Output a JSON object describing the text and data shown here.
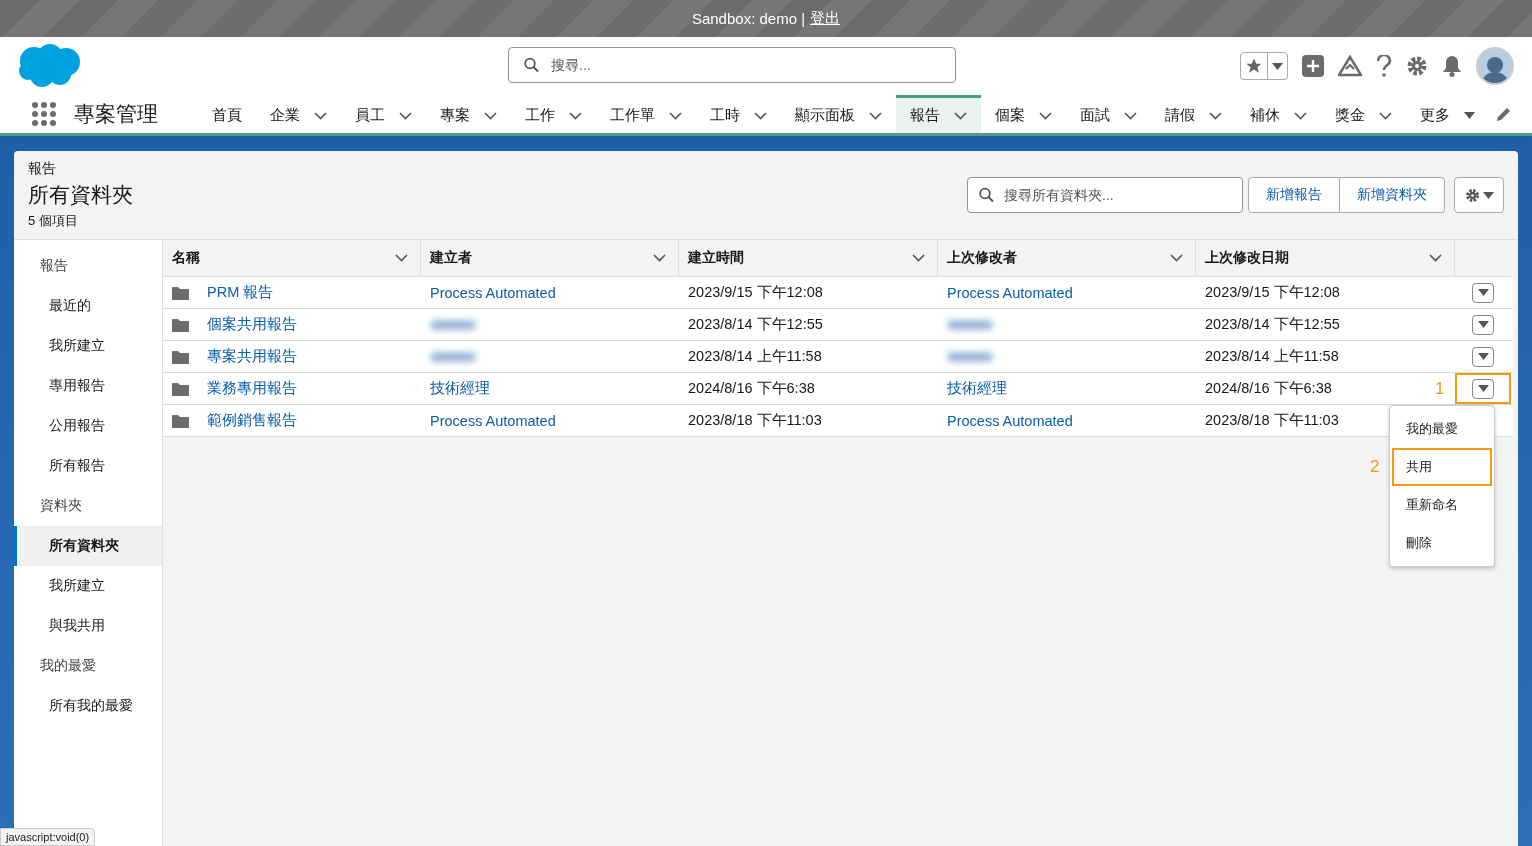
{
  "sandbox_bar": {
    "text": "Sandbox: demo |",
    "link": "登出"
  },
  "header": {
    "search": {
      "placeholder": "搜尋..."
    }
  },
  "app_name": "專案管理",
  "nav": [
    {
      "label": "首頁",
      "kind": "plain",
      "selected": false
    },
    {
      "label": "企業",
      "kind": "dropdown",
      "selected": false
    },
    {
      "label": "員工",
      "kind": "dropdown",
      "selected": false
    },
    {
      "label": "專案",
      "kind": "dropdown",
      "selected": false
    },
    {
      "label": "工作",
      "kind": "dropdown",
      "selected": false
    },
    {
      "label": "工作單",
      "kind": "dropdown",
      "selected": false
    },
    {
      "label": "工時",
      "kind": "dropdown",
      "selected": false
    },
    {
      "label": "顯示面板",
      "kind": "dropdown",
      "selected": false
    },
    {
      "label": "報告",
      "kind": "dropdown",
      "selected": true
    },
    {
      "label": "個案",
      "kind": "dropdown",
      "selected": false
    },
    {
      "label": "面試",
      "kind": "dropdown",
      "selected": false
    },
    {
      "label": "請假",
      "kind": "dropdown",
      "selected": false
    },
    {
      "label": "補休",
      "kind": "dropdown",
      "selected": false
    },
    {
      "label": "獎金",
      "kind": "dropdown",
      "selected": false
    },
    {
      "label": "更多",
      "kind": "more",
      "selected": false
    }
  ],
  "page": {
    "breadcrumb": "報告",
    "title": "所有資料夾",
    "count": "5 個項目",
    "search": {
      "placeholder": "搜尋所有資料夾..."
    },
    "buttons": [
      "新增報告",
      "新增資料夾"
    ]
  },
  "sidebar": [
    {
      "heading": "報告",
      "items": [
        {
          "label": "最近的",
          "selected": false
        },
        {
          "label": "我所建立",
          "selected": false
        },
        {
          "label": "專用報告",
          "selected": false
        },
        {
          "label": "公用報告",
          "selected": false
        },
        {
          "label": "所有報告",
          "selected": false
        }
      ]
    },
    {
      "heading": "資料夾",
      "items": [
        {
          "label": "所有資料夾",
          "selected": true
        },
        {
          "label": "我所建立",
          "selected": false
        },
        {
          "label": "與我共用",
          "selected": false
        }
      ]
    },
    {
      "heading": "我的最愛",
      "items": [
        {
          "label": "所有我的最愛",
          "selected": false
        }
      ]
    }
  ],
  "table": {
    "columns": [
      "名稱",
      "建立者",
      "建立時間",
      "上次修改者",
      "上次修改日期"
    ],
    "rows": [
      {
        "name": "PRM 報告",
        "created_by": {
          "kind": "link",
          "text": "Process Automated"
        },
        "created": "2023/9/15 下午12:08",
        "modified_by": {
          "kind": "link",
          "text": "Process Automated"
        },
        "modified": "2023/9/15 下午12:08",
        "action_button": true
      },
      {
        "name": "個案共用報告",
        "created_by": {
          "kind": "redacted"
        },
        "created": "2023/8/14 下午12:55",
        "modified_by": {
          "kind": "redacted"
        },
        "modified": "2023/8/14 下午12:55",
        "action_button": true
      },
      {
        "name": "專案共用報告",
        "created_by": {
          "kind": "redacted"
        },
        "created": "2023/8/14 上午11:58",
        "modified_by": {
          "kind": "redacted"
        },
        "modified": "2023/8/14 上午11:58",
        "action_button": true
      },
      {
        "name": "業務專用報告",
        "created_by": {
          "kind": "link",
          "text": "技術經理"
        },
        "created": "2024/8/16 下午6:38",
        "modified_by": {
          "kind": "link",
          "text": "技術經理"
        },
        "modified": "2024/8/16 下午6:38",
        "action_button": true,
        "marker": "1"
      },
      {
        "name": "範例銷售報告",
        "created_by": {
          "kind": "link",
          "text": "Process Automated"
        },
        "created": "2023/8/18 下午11:03",
        "modified_by": {
          "kind": "link",
          "text": "Process Automated"
        },
        "modified": "2023/8/18 下午11:03",
        "action_button": false
      }
    ]
  },
  "row_menu": {
    "items": [
      {
        "label": "我的最愛"
      },
      {
        "label": "共用",
        "marker": "2"
      },
      {
        "label": "重新命名"
      },
      {
        "label": "刪除"
      }
    ]
  },
  "status_bar": "javascript:void(0)"
}
